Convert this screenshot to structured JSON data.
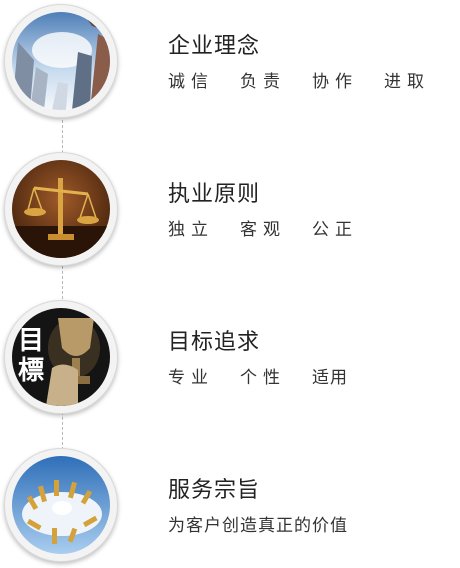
{
  "sections": [
    {
      "title": "企业理念",
      "icon": "city-skyline-icon",
      "words": [
        "诚信",
        "负责",
        "协作",
        "进取"
      ]
    },
    {
      "title": "执业原则",
      "icon": "justice-scale-icon",
      "words": [
        "独立",
        "客观",
        "公正"
      ]
    },
    {
      "title": "目标追求",
      "icon": "trophy-goal-icon",
      "icon_text": "目標",
      "words": [
        "专业",
        "个性",
        "适用"
      ]
    },
    {
      "title": "服务宗旨",
      "icon": "coin-globe-icon",
      "text": "为客户创造真正的价值"
    }
  ]
}
